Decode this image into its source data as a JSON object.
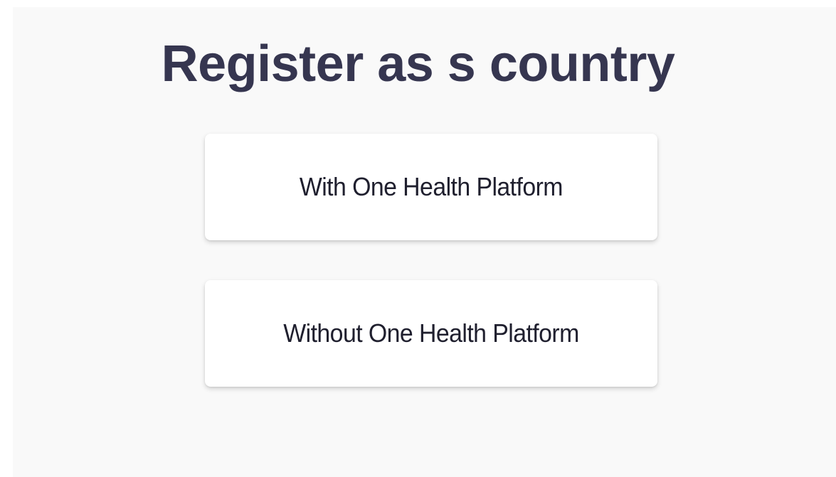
{
  "page": {
    "title": "Register as s country"
  },
  "options": [
    {
      "label": "With One Health Platform"
    },
    {
      "label": "Without One Health Platform"
    }
  ],
  "colors": {
    "background": "#f9f9f9",
    "card": "#ffffff",
    "title_text": "#363650",
    "option_text": "#1f1f2e"
  }
}
